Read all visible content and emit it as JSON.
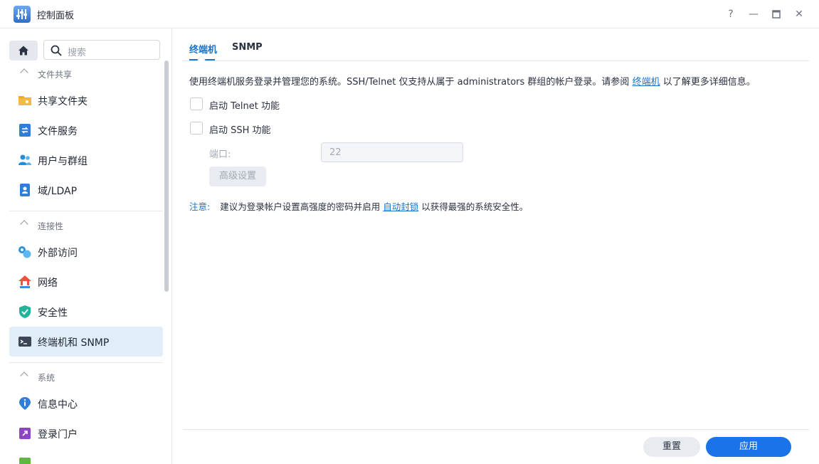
{
  "window": {
    "title": "控制面板",
    "help_icon": "?",
    "minimize_icon": "—",
    "maximize_icon": "▭",
    "close_icon": "✕"
  },
  "sidebar": {
    "search_placeholder": "搜索",
    "sections": [
      {
        "label": "文件共享",
        "items": [
          {
            "label": "共享文件夹",
            "icon": "folder-icon"
          },
          {
            "label": "文件服务",
            "icon": "file-service-icon"
          },
          {
            "label": "用户与群组",
            "icon": "users-icon"
          },
          {
            "label": "域/LDAP",
            "icon": "ldap-icon"
          }
        ]
      },
      {
        "label": "连接性",
        "items": [
          {
            "label": "外部访问",
            "icon": "external-access-icon"
          },
          {
            "label": "网络",
            "icon": "network-icon"
          },
          {
            "label": "安全性",
            "icon": "shield-icon"
          },
          {
            "label": "终端机和 SNMP",
            "icon": "terminal-icon",
            "active": true
          }
        ]
      },
      {
        "label": "系统",
        "items": [
          {
            "label": "信息中心",
            "icon": "info-icon"
          },
          {
            "label": "登录门户",
            "icon": "login-portal-icon"
          }
        ]
      }
    ]
  },
  "main": {
    "tabs": [
      {
        "label": "终端机",
        "active": true
      },
      {
        "label": "SNMP",
        "active": false
      }
    ],
    "description_prefix": "使用终端机服务登录并管理您的系统。SSH/Telnet 仅支持从属于 administrators 群组的帐户登录。请参阅",
    "description_link": "终端机",
    "description_suffix": "以了解更多详细信息。",
    "telnet_label": "启动 Telnet 功能",
    "telnet_checked": false,
    "ssh_label": "启动 SSH 功能",
    "ssh_checked": false,
    "port_label": "端口:",
    "port_value": "22",
    "advanced_button": "高级设置",
    "note_keyword": "注意:",
    "note_prefix": "建议为登录帐户设置高强度的密码并启用",
    "note_link": "自动封锁",
    "note_suffix": "以获得最强的系统安全性。"
  },
  "footer": {
    "reset_label": "重置",
    "apply_label": "应用"
  },
  "colors": {
    "accent": "#1a73e8",
    "active_item_bg": "#e1edf9"
  }
}
